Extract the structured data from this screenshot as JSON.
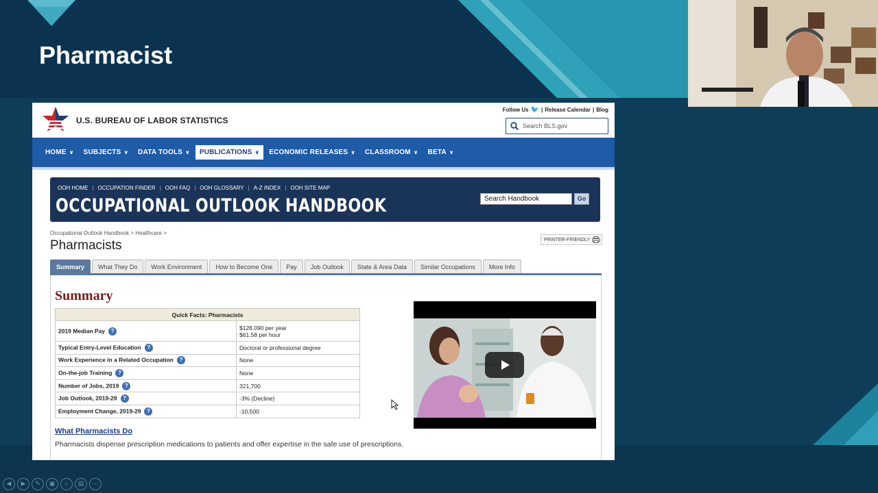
{
  "slide": {
    "title": "Pharmacist"
  },
  "bls": {
    "org_name": "U.S. BUREAU OF LABOR STATISTICS",
    "follow_us": "Follow Us",
    "release_calendar": "Release Calendar",
    "blog": "Blog",
    "search_placeholder": "Search BLS.gov"
  },
  "nav": {
    "items": [
      {
        "label": "HOME"
      },
      {
        "label": "SUBJECTS"
      },
      {
        "label": "DATA TOOLS"
      },
      {
        "label": "PUBLICATIONS"
      },
      {
        "label": "ECONOMIC RELEASES"
      },
      {
        "label": "CLASSROOM"
      },
      {
        "label": "BETA"
      }
    ]
  },
  "ooh": {
    "links": [
      "OOH HOME",
      "OCCUPATION FINDER",
      "OOH FAQ",
      "OOH GLOSSARY",
      "A-Z INDEX",
      "OOH SITE MAP"
    ],
    "title": "OCCUPATIONAL OUTLOOK HANDBOOK",
    "search_value": "Search Handbook",
    "go_label": "Go"
  },
  "breadcrumb": "Occupational Outlook Handbook > Healthcare >",
  "page_title": "Pharmacists",
  "printer_friendly": "PRINTER-FRIENDLY",
  "tabs": [
    {
      "label": "Summary"
    },
    {
      "label": "What They Do"
    },
    {
      "label": "Work Environment"
    },
    {
      "label": "How to Become One"
    },
    {
      "label": "Pay"
    },
    {
      "label": "Job Outlook"
    },
    {
      "label": "State & Area Data"
    },
    {
      "label": "Similar Occupations"
    },
    {
      "label": "More Info"
    }
  ],
  "summary": {
    "heading": "Summary",
    "quick_facts_title": "Quick Facts: Pharmacists",
    "rows": [
      {
        "label": "2019 Median Pay",
        "value": "$128,090 per year",
        "value2": "$61.58 per hour"
      },
      {
        "label": "Typical Entry-Level Education",
        "value": "Doctoral or professional degree"
      },
      {
        "label": "Work Experience in a Related Occupation",
        "value": "None"
      },
      {
        "label": "On-the-job Training",
        "value": "None"
      },
      {
        "label": "Number of Jobs, 2019",
        "value": "321,700"
      },
      {
        "label": "Job Outlook, 2019-29",
        "value": "-3% (Decline)"
      },
      {
        "label": "Employment Change, 2019-29",
        "value": "-10,500"
      }
    ],
    "what_link": "What Pharmacists Do",
    "what_text": "Pharmacists dispense prescription medications to patients and offer expertise in the safe use of prescriptions."
  }
}
